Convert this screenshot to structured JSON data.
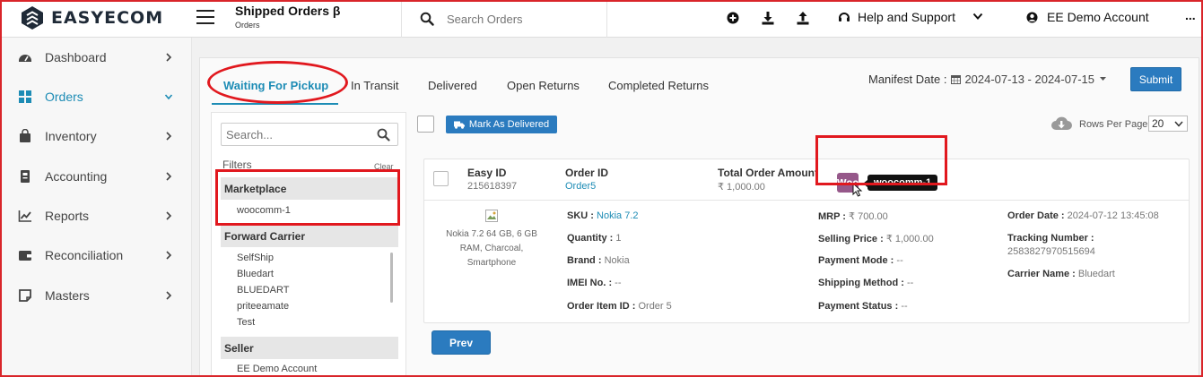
{
  "app": {
    "brand": "EASYECOM"
  },
  "header": {
    "title": "Shipped Orders β",
    "subtitle": "Orders",
    "search_placeholder": "Search Orders",
    "help_label": "Help and Support",
    "account_label": "EE Demo Account",
    "more_label": "..."
  },
  "sidebar": {
    "items": [
      {
        "label": "Dashboard",
        "icon": "dashboard-icon"
      },
      {
        "label": "Orders",
        "icon": "grid-icon",
        "active": true
      },
      {
        "label": "Inventory",
        "icon": "bag-icon"
      },
      {
        "label": "Accounting",
        "icon": "ledger-icon"
      },
      {
        "label": "Reports",
        "icon": "line-chart-icon"
      },
      {
        "label": "Reconciliation",
        "icon": "wallet-icon"
      },
      {
        "label": "Masters",
        "icon": "note-icon"
      }
    ]
  },
  "tabs": [
    "Waiting For Pickup",
    "In Transit",
    "Delivered",
    "Open Returns",
    "Completed Returns"
  ],
  "manifest": {
    "label": "Manifest Date :",
    "range": "2024-07-13 - 2024-07-15",
    "submit": "Submit"
  },
  "filters": {
    "search_placeholder": "Search...",
    "title": "Filters",
    "clear": "Clear",
    "marketplace": {
      "heading": "Marketplace",
      "items": [
        "woocomm-1"
      ]
    },
    "carrier": {
      "heading": "Forward Carrier",
      "items": [
        "SelfShip",
        "Bluedart",
        "BLUEDART",
        "priteeamate",
        "Test"
      ]
    },
    "seller": {
      "heading": "Seller",
      "items": [
        "EE Demo Account"
      ]
    }
  },
  "toolbar": {
    "mark_delivered": "Mark As Delivered",
    "rows_per_page_label": "Rows Per Page",
    "rows_per_page": "20"
  },
  "order": {
    "easy_id_label": "Easy ID",
    "easy_id": "215618397",
    "order_id_label": "Order ID",
    "order_id": "Order5",
    "total_label": "Total Order Amount",
    "total": "₹ 1,000.00",
    "marketplace_logo_text": "Woo",
    "marketplace_tooltip": "woocomm-1",
    "product_name": "Nokia 7.2 64 GB, 6 GB RAM, Charcoal, Smartphone",
    "sku_label": "SKU :",
    "sku": "Nokia 7.2",
    "quantity_label": "Quantity :",
    "quantity": "1",
    "brand_label": "Brand :",
    "brand": "Nokia",
    "imei_label": "IMEI No. :",
    "imei": "--",
    "order_item_id_label": "Order Item ID :",
    "order_item_id": "Order 5",
    "mrp_label": "MRP :",
    "mrp": "₹ 700.00",
    "selling_price_label": "Selling Price :",
    "selling_price": "₹ 1,000.00",
    "payment_mode_label": "Payment Mode :",
    "payment_mode": "--",
    "shipping_method_label": "Shipping Method :",
    "shipping_method": "--",
    "payment_status_label": "Payment Status :",
    "payment_status": "--",
    "order_date_label": "Order Date :",
    "order_date": "2024-07-12 13:45:08",
    "tracking_label": "Tracking Number :",
    "tracking": "2583827970515694",
    "carrier_label": "Carrier Name :",
    "carrier": "Bluedart"
  },
  "pagination": {
    "prev": "Prev"
  },
  "colors": {
    "accent": "#1d8cb5",
    "button": "#2b7bbf",
    "annotation": "#e1181e",
    "woo": "#96588a"
  }
}
